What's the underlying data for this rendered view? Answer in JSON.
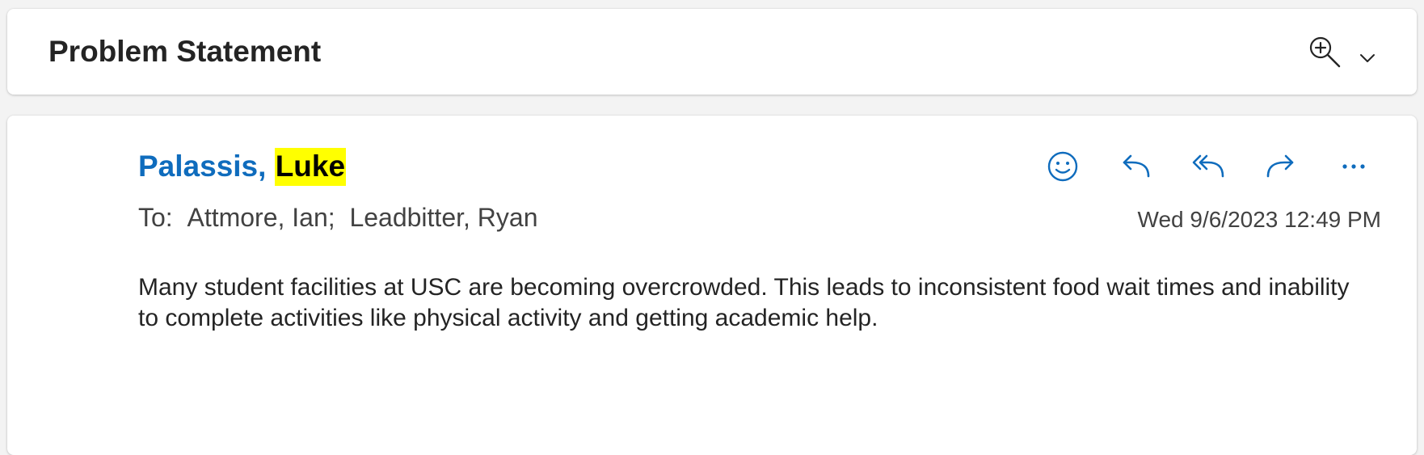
{
  "header": {
    "subject": "Problem Statement",
    "zoom_icon": "zoom-in-icon",
    "expand_icon": "chevron-down-icon"
  },
  "message": {
    "sender_last": "Palassis, ",
    "sender_first_highlighted": "Luke",
    "to_label": "To:",
    "recipients": [
      "Attmore, Ian;",
      "Leadbitter, Ryan"
    ],
    "date": "Wed 9/6/2023 12:49 PM",
    "actions": [
      {
        "icon": "emoji-reaction-icon"
      },
      {
        "icon": "reply-icon"
      },
      {
        "icon": "reply-all-icon"
      },
      {
        "icon": "forward-icon"
      },
      {
        "icon": "more-actions-icon"
      }
    ],
    "body": "Many student facilities at USC are becoming overcrowded. This leads to inconsistent food wait times and inability to complete activities like physical activity and getting academic help."
  },
  "colors": {
    "accent": "#0f6cbd",
    "highlight": "#ffff00",
    "text": "#242424",
    "secondary_text": "#424242",
    "background": "#f3f3f3",
    "card": "#ffffff"
  }
}
